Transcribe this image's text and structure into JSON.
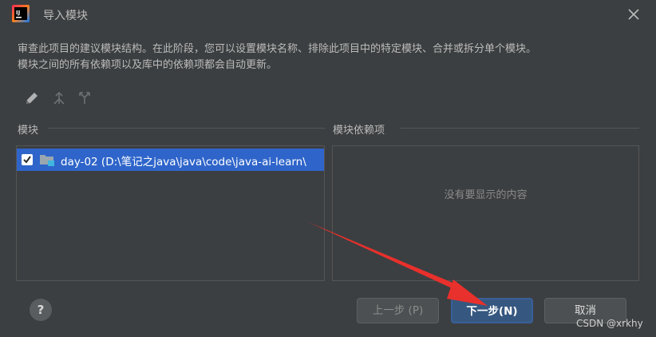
{
  "window": {
    "title": "导入模块"
  },
  "description": {
    "line1": "审查此项目的建议模块结构。在此阶段，您可以设置模块名称、排除此项目中的特定模块、合并或拆分单个模块。",
    "line2": "模块之间的所有依赖项以及库中的依赖项都会自动更新。"
  },
  "toolbar": {
    "icons": [
      "pencil-icon",
      "merge-icon",
      "split-icon"
    ]
  },
  "modules": {
    "label": "模块",
    "items": [
      {
        "name": "day-02 (D:\\笔记之java\\java\\code\\java-ai-learn\\",
        "checked": true
      }
    ]
  },
  "dependencies": {
    "label": "模块依赖项",
    "empty_text": "没有要显示的内容"
  },
  "buttons": {
    "help": "?",
    "prev": "上一步 (P)",
    "next": "下一步(N)",
    "cancel": "取消"
  },
  "annotation": {
    "arrow_color": "#e8302c"
  },
  "watermark": "CSDN @xrkhy"
}
